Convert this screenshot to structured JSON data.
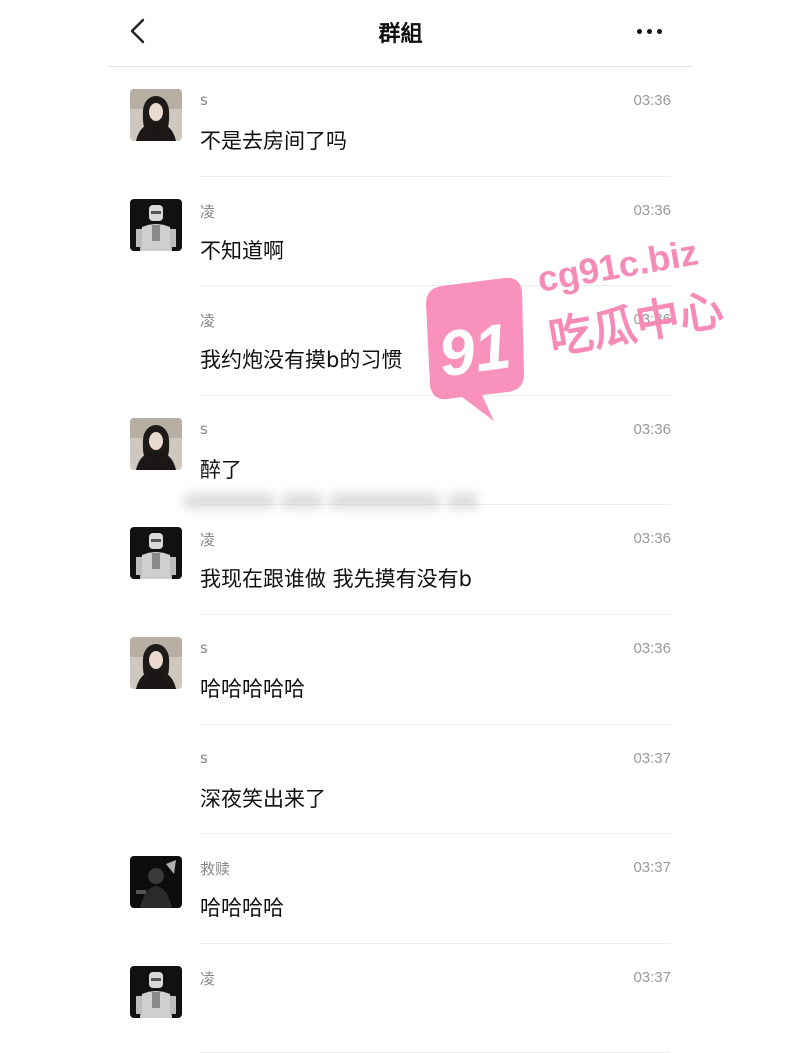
{
  "header": {
    "title": "群組",
    "back_icon": "chevron-left-icon",
    "more_icon": "more-dots-icon"
  },
  "messages": [
    {
      "sender": "s",
      "time": "03:36",
      "text": "不是去房间了吗",
      "avatar": "woman"
    },
    {
      "sender": "凌",
      "time": "03:36",
      "text": "不知道啊",
      "avatar": "robot"
    },
    {
      "sender": "凌",
      "time": "03:36",
      "text": "我约炮没有摸b的习惯",
      "avatar": "none"
    },
    {
      "sender": "s",
      "time": "03:36",
      "text": "醉了",
      "avatar": "woman"
    },
    {
      "sender": "凌",
      "time": "03:36",
      "text": "我现在跟谁做 我先摸有没有b",
      "avatar": "robot"
    },
    {
      "sender": "s",
      "time": "03:36",
      "text": "哈哈哈哈哈",
      "avatar": "woman"
    },
    {
      "sender": "s",
      "time": "03:37",
      "text": "深夜笑出来了",
      "avatar": "none"
    },
    {
      "sender": "救赎",
      "time": "03:37",
      "text": "哈哈哈哈",
      "avatar": "dark"
    },
    {
      "sender": "凌",
      "time": "03:37",
      "text": "",
      "avatar": "robot"
    }
  ],
  "watermark": {
    "number": "91",
    "domain": "cg91c.biz",
    "name": "吃瓜中心",
    "color": "#f77fb0"
  }
}
